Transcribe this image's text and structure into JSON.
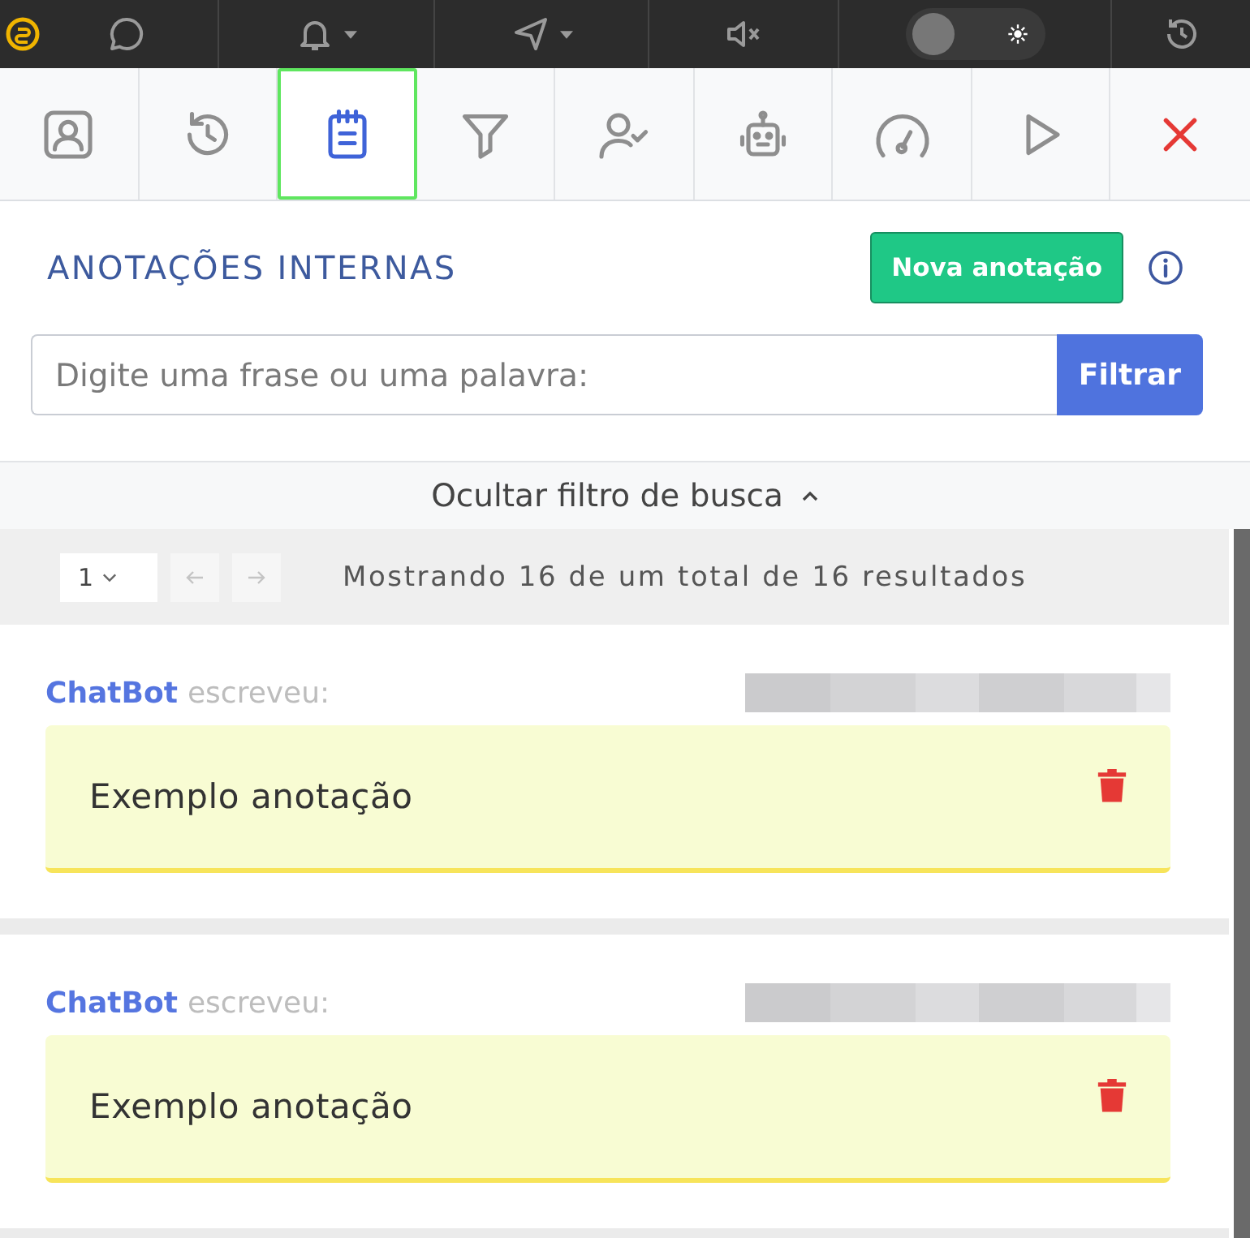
{
  "top_bar": {
    "theme_toggle": {
      "on": false
    }
  },
  "tabs": [
    {
      "kind": "contact",
      "selected": false
    },
    {
      "kind": "history",
      "selected": false
    },
    {
      "kind": "notes",
      "selected": true
    },
    {
      "kind": "filter",
      "selected": false
    },
    {
      "kind": "user-check",
      "selected": false
    },
    {
      "kind": "robot",
      "selected": false
    },
    {
      "kind": "gauge",
      "selected": false
    },
    {
      "kind": "play",
      "selected": false
    }
  ],
  "panel": {
    "title": "ANOTAÇÕES INTERNAS",
    "new_button": "Nova anotação"
  },
  "search": {
    "placeholder": "Digite uma frase ou uma palavra:",
    "button": "Filtrar"
  },
  "filter_toggle": {
    "label": "Ocultar filtro de busca",
    "expanded": true
  },
  "pagination": {
    "page": "1",
    "previous": {
      "disabled": true
    },
    "next": {
      "disabled": true
    },
    "summary": "Mostrando 16 de um total de 16 resultados"
  },
  "notes": [
    {
      "author": "ChatBot",
      "action": "escreveu:",
      "text": "Exemplo anotação"
    },
    {
      "author": "ChatBot",
      "action": "escreveu:",
      "text": "Exemplo anotação"
    }
  ]
}
